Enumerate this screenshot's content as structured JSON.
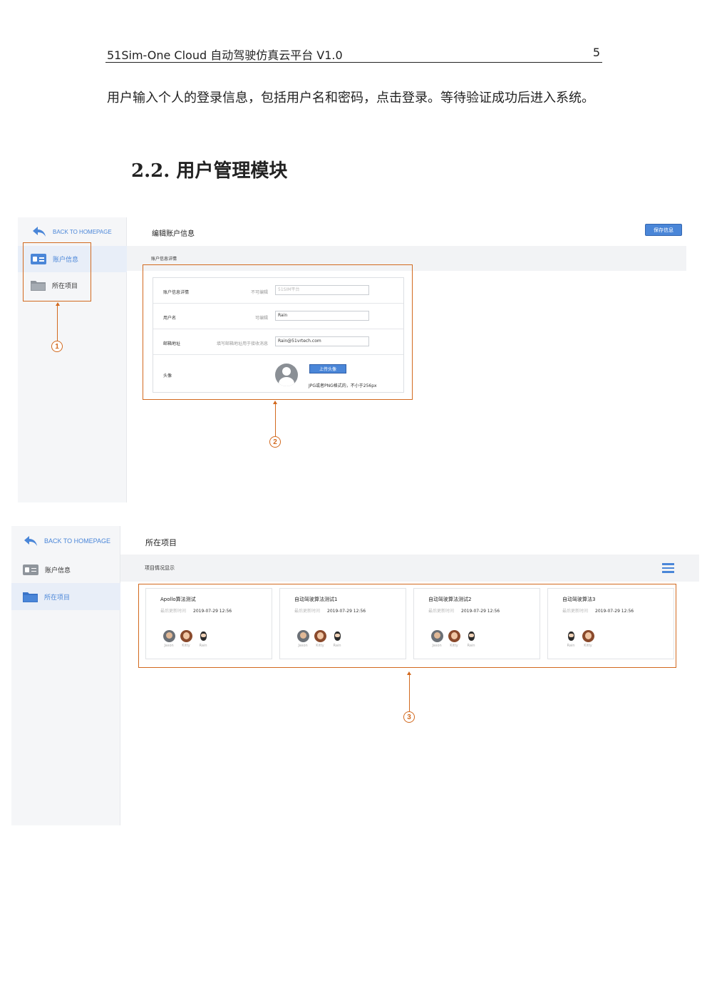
{
  "header": {
    "title": "51Sim-One Cloud 自动驾驶仿真云平台 V1.0",
    "page_number": "5"
  },
  "paragraph": "用户输入个人的登录信息，包括用户名和密码，点击登录。等待验证成功后进入系统。",
  "section_title": "2.2. 用户管理模块",
  "screenshot1": {
    "back_label": "BACK TO HOMEPAGE",
    "sidebar": [
      {
        "label": "账户信息",
        "active": true
      },
      {
        "label": "所在项目",
        "active": false
      }
    ],
    "page_title": "编辑账户信息",
    "save_button": "保存信息",
    "subbar_label": "账户信息详情",
    "form": {
      "rows": [
        {
          "label": "账户信息详情",
          "hint": "不可编辑",
          "value": "51SIM平台"
        },
        {
          "label": "用户名",
          "hint": "可编辑",
          "value": "Rain"
        },
        {
          "label": "邮箱地址",
          "hint": "填写邮箱地址用于接收消息",
          "value": "Rain@51vrtech.com"
        }
      ],
      "avatar_label": "头像",
      "upload_button": "上传头像",
      "upload_note": "JPG或者PNG格式的，不小于256px"
    }
  },
  "screenshot2": {
    "back_label": "BACK TO HOMEPAGE",
    "sidebar": [
      {
        "label": "账户信息",
        "active": false
      },
      {
        "label": "所在项目",
        "active": true
      }
    ],
    "page_title": "所在项目",
    "subbar_label": "项目情况显示",
    "projects": [
      {
        "name": "Apollo算法测试",
        "updated_label": "最后更新时间",
        "updated": "2019-07-29 12:56",
        "members": [
          "Jason",
          "Kitty",
          "Rain"
        ]
      },
      {
        "name": "自动驾驶算法测试1",
        "updated_label": "最后更新时间",
        "updated": "2019-07-29 12:56",
        "members": [
          "Jason",
          "Kitty",
          "Rain"
        ]
      },
      {
        "name": "自动驾驶算法测试2",
        "updated_label": "最后更新时间",
        "updated": "2019-07-29 12:56",
        "members": [
          "Jason",
          "Kitty",
          "Rain"
        ]
      },
      {
        "name": "自动驾驶算法3",
        "updated_label": "最后更新时间",
        "updated": "2019-07-29 12:56",
        "members": [
          "Rain",
          "Kitty"
        ]
      }
    ]
  },
  "annotations": [
    "1",
    "2",
    "3"
  ],
  "colors": {
    "accent": "#4a86d8",
    "annotation": "#d2691e"
  }
}
